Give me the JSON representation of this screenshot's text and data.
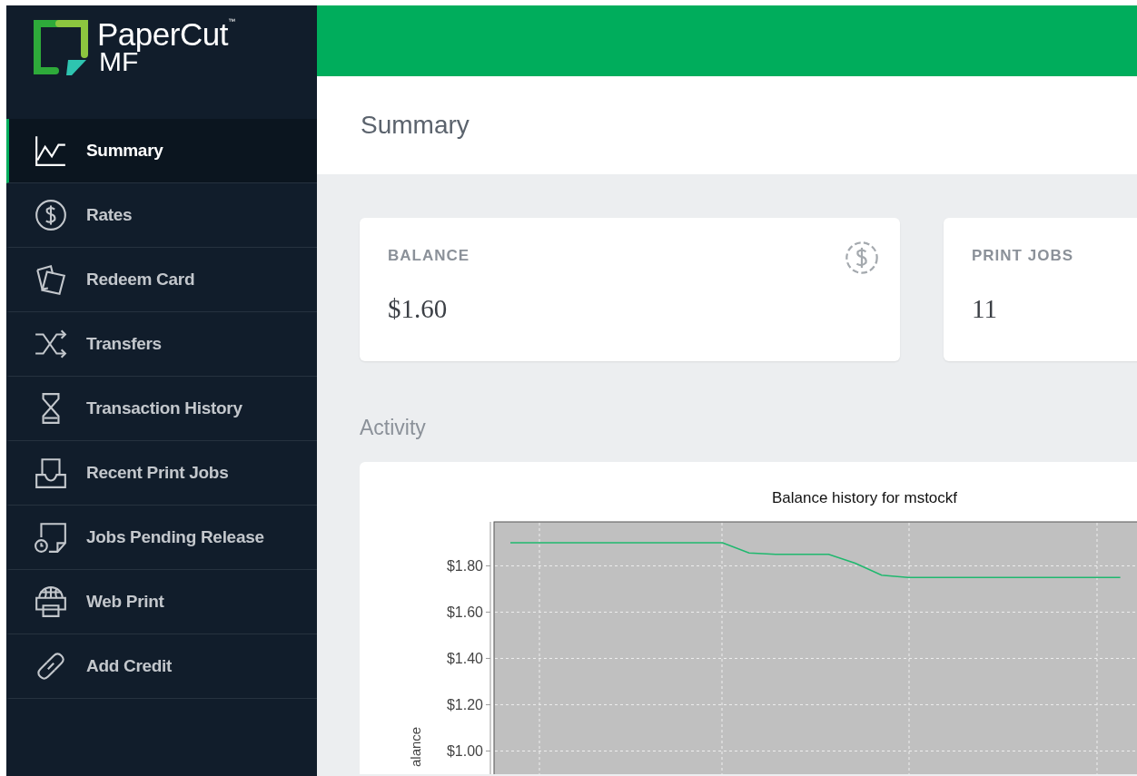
{
  "logo": {
    "name": "PaperCut",
    "trademark": "™",
    "product": "MF"
  },
  "nav": [
    {
      "label": "Summary",
      "selected": true
    },
    {
      "label": "Rates",
      "selected": false
    },
    {
      "label": "Redeem Card",
      "selected": false
    },
    {
      "label": "Transfers",
      "selected": false
    },
    {
      "label": "Transaction History",
      "selected": false
    },
    {
      "label": "Recent Print Jobs",
      "selected": false
    },
    {
      "label": "Jobs Pending Release",
      "selected": false
    },
    {
      "label": "Web Print",
      "selected": false
    },
    {
      "label": "Add Credit",
      "selected": false
    }
  ],
  "page_title": "Summary",
  "cards": [
    {
      "label": "BALANCE",
      "value": "$1.60"
    },
    {
      "label": "PRINT JOBS",
      "value": "11"
    }
  ],
  "activity": {
    "heading": "Activity",
    "chart_data": {
      "type": "line",
      "title": "Balance history for mstockf",
      "ylabel": "alance",
      "grid": true,
      "ylim": [
        0.9,
        1.99
      ],
      "yticks": [
        {
          "value": 1.0,
          "label": "$1.00"
        },
        {
          "value": 1.2,
          "label": "$1.20"
        },
        {
          "value": 1.4,
          "label": "$1.40"
        },
        {
          "value": 1.6,
          "label": "$1.60"
        },
        {
          "value": 1.8,
          "label": "$1.80"
        }
      ],
      "series": [
        {
          "color": "#1fb86e",
          "values": [
            1.9,
            1.9,
            1.9,
            1.9,
            1.9,
            1.9,
            1.9,
            1.9,
            1.9,
            1.856,
            1.85,
            1.85,
            1.85,
            1.812,
            1.76,
            1.75,
            1.75,
            1.75,
            1.75,
            1.75,
            1.75,
            1.75,
            1.75,
            1.75
          ]
        }
      ]
    }
  }
}
